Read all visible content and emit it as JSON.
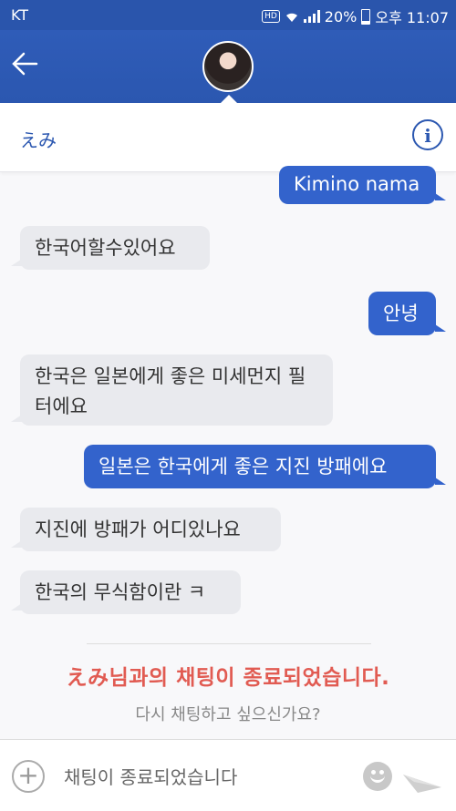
{
  "status_bar": {
    "carrier": "KT",
    "hd": "HD",
    "battery": "20%",
    "time": "오후 11:07"
  },
  "header": {
    "contact_name": "えみ",
    "info_icon": "i"
  },
  "messages": [
    {
      "dir": "out",
      "text": "Kimino nama"
    },
    {
      "dir": "in",
      "text": "한국어할수있어요"
    },
    {
      "dir": "out",
      "text": "안녕"
    },
    {
      "dir": "in",
      "text": "한국은 일본에게 좋은 미세먼지 필터에요"
    },
    {
      "dir": "out",
      "text": "일본은 한국에게 좋은 지진 방패에요"
    },
    {
      "dir": "in",
      "text": "지진에 방패가 어디있나요"
    },
    {
      "dir": "in",
      "text": "한국의 무식함이란 ㅋ"
    }
  ],
  "chat_end": {
    "notice": "えみ님과의 채팅이 종료되었습니다.",
    "retry": "다시 채팅하고 싶으신가요?"
  },
  "composer": {
    "placeholder": "채팅이 종료되었습니다"
  },
  "colors": {
    "header": "#2b57b0",
    "bubble_out": "#3363cc",
    "bubble_in": "#e9eaee",
    "notice": "#e15b52"
  },
  "icons": [
    "back-arrow-icon",
    "info-icon",
    "plus-icon",
    "emoji-icon",
    "send-icon",
    "wifi-icon",
    "signal-icon",
    "battery-icon"
  ]
}
